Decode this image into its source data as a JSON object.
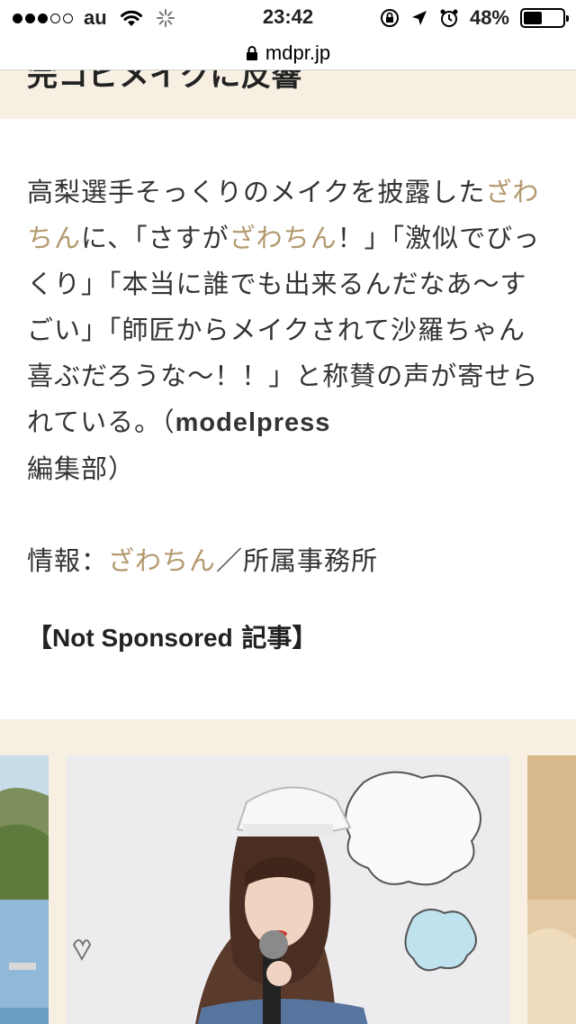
{
  "status_bar": {
    "carrier": "au",
    "time": "23:42",
    "battery_percent": "48%",
    "battery_level": 0.48,
    "signal_bars_filled": 3,
    "signal_bars_total": 5
  },
  "url_bar": {
    "domain": "mdpr.jp"
  },
  "headline": {
    "text": "完コピメイクに反響"
  },
  "article": {
    "p1_a": "高梨選手そっくりのメイクを披露した",
    "p1_link1": "ざわちん",
    "p1_b": "に、「さすが",
    "p1_link2": "ざわちん",
    "p1_c": "！」「激似でびっくり」「本当に誰でも出来るんだなあ～すごい」「師匠からメイクされて沙羅ちゃん喜ぶだろうな～！！」と称賛の声が寄せられている。（",
    "p1_credit": "modelpress",
    "p1_d": "編集部）",
    "info_label": "情報：",
    "info_link": "ざわちん",
    "info_rest": "／所属事務所",
    "sponsor_open": "【",
    "sponsor_latin": "Not Sponsored",
    "sponsor_rest": " 記事】"
  },
  "colors": {
    "link": "#b3996e",
    "band_bg": "#f7efe2"
  }
}
